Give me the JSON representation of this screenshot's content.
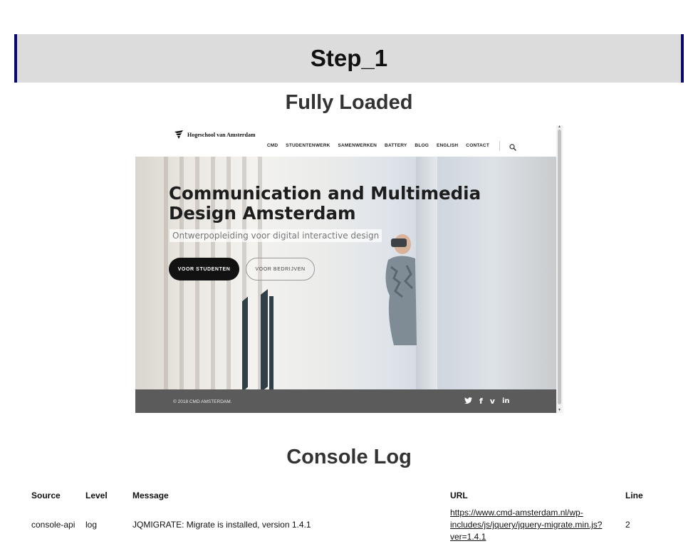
{
  "step": {
    "title": "Step_1"
  },
  "sections": {
    "fully_loaded": "Fully Loaded",
    "console_log": "Console Log"
  },
  "screenshot": {
    "logo_text": "Hogeschool van Amsterdam",
    "nav_items": [
      "CMD",
      "STUDENTENWERK",
      "SAMENWERKEN",
      "BATTERY",
      "BLOG",
      "ENGLISH",
      "CONTACT"
    ],
    "hero_title_line1": "Communication and Multimedia",
    "hero_title_line2": "Design Amsterdam",
    "hero_subtitle": "Ontwerpopleiding voor digital interactive design",
    "primary_button": "VOOR STUDENTEN",
    "secondary_button": "VOOR BEDRIJVEN",
    "footer_copy": "© 2018 CMD AMSTERDAM.",
    "social_icons": [
      "twitter-icon",
      "facebook-icon",
      "vimeo-icon",
      "linkedin-icon"
    ]
  },
  "console": {
    "headers": {
      "source": "Source",
      "level": "Level",
      "message": "Message",
      "url": "URL",
      "line": "Line"
    },
    "rows": [
      {
        "source": "console-api",
        "level": "log",
        "message": "JQMIGRATE: Migrate is installed, version 1.4.1",
        "url": "https://www.cmd-amsterdam.nl/wp-includes/js/jquery/jquery-migrate.min.js?ver=1.4.1",
        "line": "2"
      }
    ]
  },
  "colors": {
    "header_bg": "#dcdcdc",
    "header_border": "#0a0a6e",
    "footer_bg": "#5b5b5b"
  }
}
